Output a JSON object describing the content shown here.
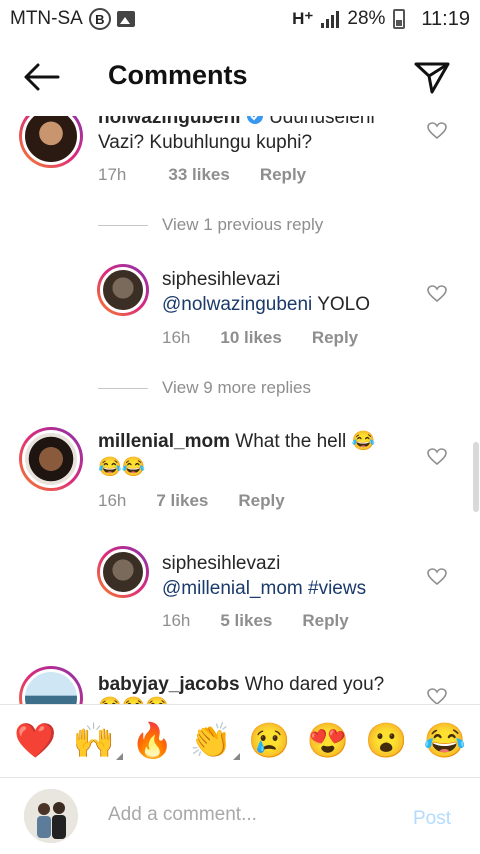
{
  "status_bar": {
    "carrier": "MTN-SA",
    "badge": "B",
    "network": "H⁺",
    "battery": "28%",
    "time": "11:19"
  },
  "header": {
    "title": "Comments"
  },
  "comments": {
    "c1": {
      "username": "nolwazingubeni",
      "text_line1_tail": "Uduhuseleni",
      "text_line2": "Vazi? Kubuhlungu kuphi?",
      "time": "17h",
      "likes": "33 likes",
      "reply": "Reply"
    },
    "view_prev": "View 1 previous reply",
    "r1": {
      "username": "siphesihlevazi",
      "mention": "@nolwazingubeni",
      "text": " YOLO",
      "time": "16h",
      "likes": "10 likes",
      "reply": "Reply"
    },
    "view_more": "View 9 more replies",
    "c2": {
      "username": "millenial_mom",
      "text": " What the hell 😂",
      "text_line2": "😂😂",
      "time": "16h",
      "likes": "7 likes",
      "reply": "Reply"
    },
    "r2": {
      "username": "siphesihlevazi",
      "mention": "@millenial_mom",
      "hashtag": " #views",
      "time": "16h",
      "likes": "5 likes",
      "reply": "Reply"
    },
    "c3": {
      "username": "babyjay_jacobs",
      "text": " Who dared you?",
      "text_line2": "😂😂😂"
    }
  },
  "emoji_bar": [
    "❤️",
    "🙌",
    "🔥",
    "👏",
    "😢",
    "😍",
    "😮",
    "😂"
  ],
  "composer": {
    "placeholder": "Add a comment...",
    "post_label": "Post"
  },
  "colors": {
    "link": "#1a3a6b",
    "muted": "#8e8e8e",
    "post_disabled": "#b3dbff",
    "verified": "#3897f0"
  }
}
